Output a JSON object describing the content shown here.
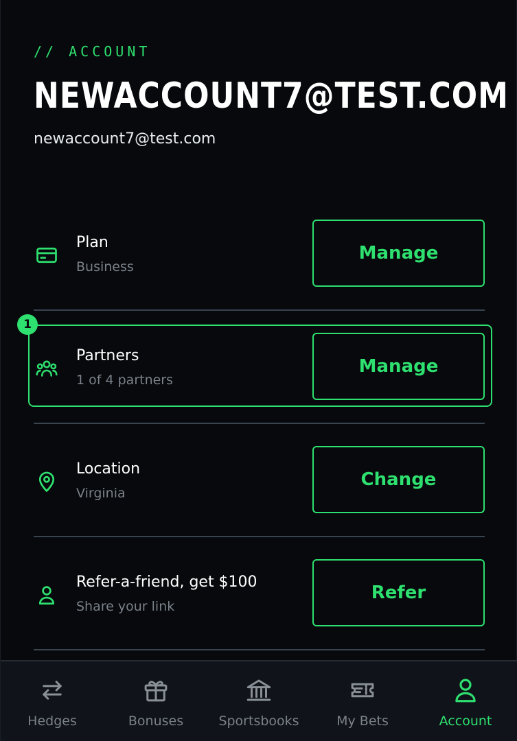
{
  "header": {
    "eyebrow": "// ACCOUNT",
    "title": "NEWACCOUNT7@TEST.COM",
    "email": "newaccount7@test.com"
  },
  "rows": [
    {
      "icon": "credit-card-icon",
      "title": "Plan",
      "subtitle": "Business",
      "button": "Manage"
    },
    {
      "icon": "users-icon",
      "title": "Partners",
      "subtitle": "1 of 4 partners",
      "button": "Manage"
    },
    {
      "icon": "location-pin-icon",
      "title": "Location",
      "subtitle": "Virginia",
      "button": "Change"
    },
    {
      "icon": "user-icon",
      "title": "Refer-a-friend, get $100",
      "subtitle": "Share your link",
      "button": "Refer"
    }
  ],
  "highlight": {
    "marker": "1"
  },
  "nav": {
    "items": [
      {
        "icon": "swap-arrows-icon",
        "label": "Hedges"
      },
      {
        "icon": "gift-icon",
        "label": "Bonuses"
      },
      {
        "icon": "bank-icon",
        "label": "Sportsbooks"
      },
      {
        "icon": "ticket-icon",
        "label": "My Bets"
      },
      {
        "icon": "user-icon",
        "label": "Account",
        "active": true
      }
    ]
  },
  "colors": {
    "accent": "#2ee06f",
    "background": "#07090c",
    "muted": "#7b818a",
    "divider": "#3a4350"
  }
}
